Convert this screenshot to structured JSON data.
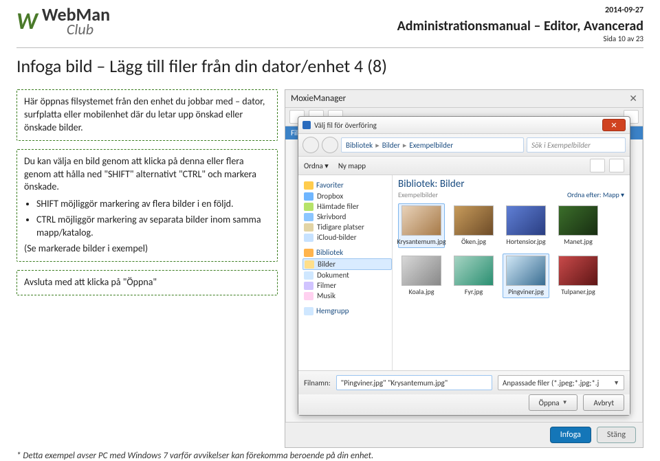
{
  "header": {
    "logo_main": "WebMan",
    "logo_sub": "Club",
    "date": "2014-09-27",
    "doc_title": "Administrationsmanual – Editor, Avancerad",
    "page_num": "Sida 10 av 23"
  },
  "section_title": "Infoga bild – Lägg till filer från din dator/enhet  4 (8)",
  "callout1": "Här öppnas filsystemet från den enhet du jobbar med – dator, surfplatta eller mobilenhet där du letar upp önskad eller önskade bilder.",
  "callout2_intro": "Du kan välja en bild genom att klicka på denna eller flera genom att hålla ned \"SHIFT\" alternativt \"CTRL\" och markera önskade.",
  "callout2_b1": "SHIFT möjliggör markering av flera bilder i en följd.",
  "callout2_b2": "CTRL möjliggör markering av separata bilder inom samma mapp/katalog.",
  "callout2_b3": "(Se markerade bilder i exempel)",
  "callout3": "Avsluta med att klicka på \"Öppna\"",
  "footnote": "* Detta exempel avser PC med Windows 7 varför avvikelser kan förekomma beroende på din enhet.",
  "moxie": {
    "title": "MoxieManager",
    "tab": "Fil",
    "insert": "Infoga",
    "close": "Stäng"
  },
  "win7": {
    "caption": "Välj fil för överföring",
    "breadcrumb": [
      "Bibliotek",
      "Bilder",
      "Exempelbilder"
    ],
    "search_placeholder": "Sök i Exempelbilder",
    "toolbar_ordna": "Ordna ▾",
    "toolbar_nymapp": "Ny mapp",
    "lib_title": "Bibliotek: Bilder",
    "lib_sub": "Exempelbilder",
    "lib_sort_lbl": "Ordna efter:",
    "lib_sort_val": "Mapp ▾",
    "side": {
      "fav": "Favoriter",
      "fav_items": [
        "Dropbox",
        "Hämtade filer",
        "Skrivbord",
        "Tidigare platser",
        "iCloud-bilder"
      ],
      "lib": "Bibliotek",
      "lib_items": [
        "Bilder",
        "Dokument",
        "Filmer",
        "Musik"
      ],
      "home": "Hemgrupp"
    },
    "thumbs": [
      {
        "label": "Krysantemum.jpg",
        "cls": "p1",
        "sel": true
      },
      {
        "label": "Öken.jpg",
        "cls": "p2",
        "sel": false
      },
      {
        "label": "Hortensior.jpg",
        "cls": "p3",
        "sel": false
      },
      {
        "label": "Manet.jpg",
        "cls": "p4",
        "sel": false
      },
      {
        "label": "Koala.jpg",
        "cls": "p5",
        "sel": false
      },
      {
        "label": "Fyr.jpg",
        "cls": "p6",
        "sel": false
      },
      {
        "label": "Pingviner.jpg",
        "cls": "p7",
        "sel": true
      },
      {
        "label": "Tulpaner.jpg",
        "cls": "p8",
        "sel": false
      }
    ],
    "fn_label": "Filnamn:",
    "fn_value": "\"Pingviner.jpg\" \"Krysantemum.jpg\"",
    "filter": "Anpassade filer (*.jpeg;*.jpg;*.j",
    "open": "Öppna",
    "cancel": "Avbryt"
  }
}
